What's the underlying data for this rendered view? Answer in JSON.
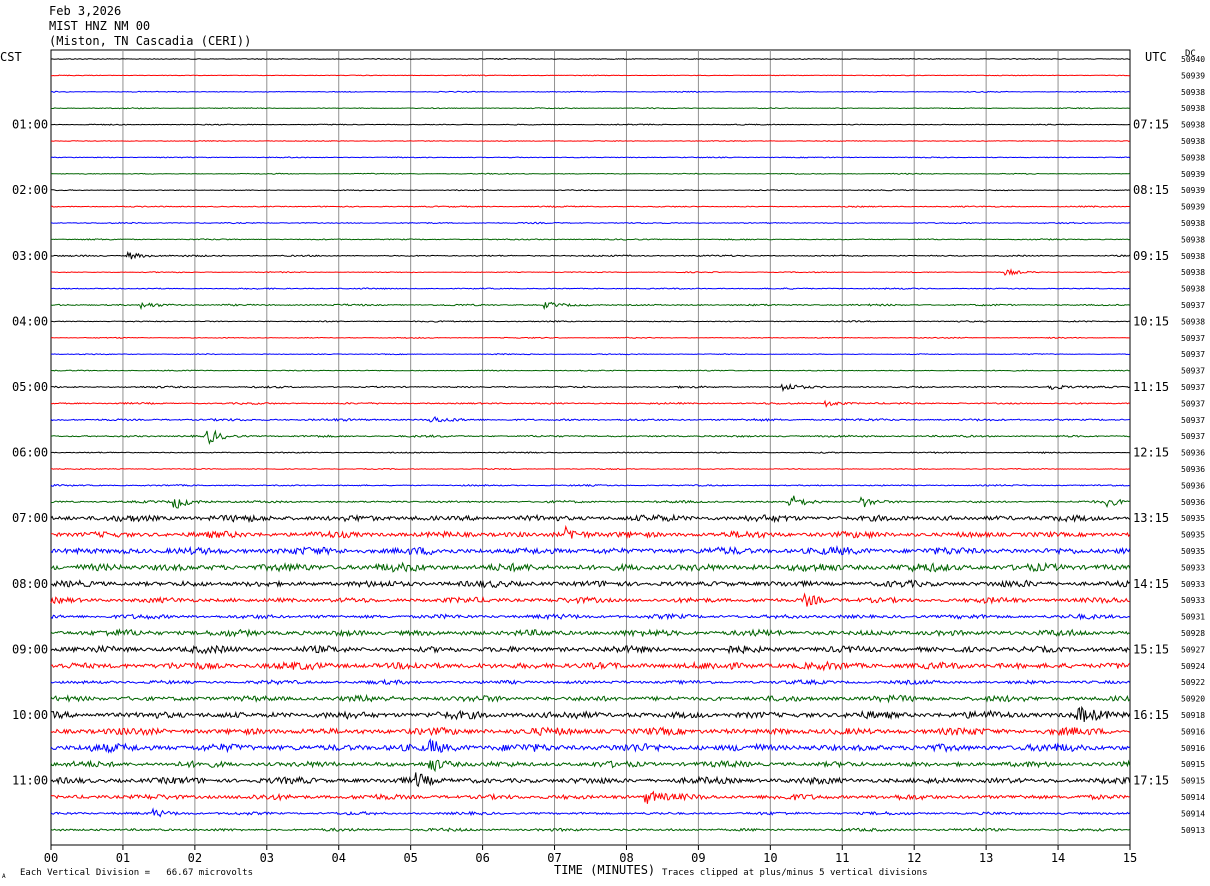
{
  "header": {
    "date": "Feb 3,2026",
    "station": "MIST HNZ NM 00",
    "location": "(Miston, TN Cascadia (CERI))"
  },
  "left_tz": "CST",
  "right_tz": "UTC",
  "dc_label": "DC",
  "footer": {
    "scale_note": "Each Vertical Division =   66.67 microvolts",
    "clip_note": "Traces clipped at plus/minus 5 vertical divisions",
    "mark": "A"
  },
  "chart_data": {
    "type": "line",
    "title": "MIST HNZ NM 00",
    "xlabel": "TIME (MINUTES)",
    "ylabel": "",
    "xlim": [
      0,
      15
    ],
    "x_ticks": [
      "00",
      "01",
      "02",
      "03",
      "04",
      "05",
      "06",
      "07",
      "08",
      "09",
      "10",
      "11",
      "12",
      "13",
      "14",
      "15"
    ],
    "left_hour_labels": [
      {
        "row": 4,
        "text": "01:00"
      },
      {
        "row": 8,
        "text": "02:00"
      },
      {
        "row": 12,
        "text": "03:00"
      },
      {
        "row": 16,
        "text": "04:00"
      },
      {
        "row": 20,
        "text": "05:00"
      },
      {
        "row": 24,
        "text": "06:00"
      },
      {
        "row": 28,
        "text": "07:00"
      },
      {
        "row": 32,
        "text": "08:00"
      },
      {
        "row": 36,
        "text": "09:00"
      },
      {
        "row": 40,
        "text": "10:00"
      },
      {
        "row": 44,
        "text": "11:00"
      }
    ],
    "right_hour_labels": [
      {
        "row": 4,
        "text": "07:15"
      },
      {
        "row": 8,
        "text": "08:15"
      },
      {
        "row": 12,
        "text": "09:15"
      },
      {
        "row": 16,
        "text": "10:15"
      },
      {
        "row": 20,
        "text": "11:15"
      },
      {
        "row": 24,
        "text": "12:15"
      },
      {
        "row": 28,
        "text": "13:15"
      },
      {
        "row": 32,
        "text": "14:15"
      },
      {
        "row": 36,
        "text": "15:15"
      },
      {
        "row": 40,
        "text": "16:15"
      },
      {
        "row": 44,
        "text": "17:15"
      }
    ],
    "trace_colors": [
      "#000000",
      "#ff0000",
      "#0000ff",
      "#006400"
    ],
    "grid_color": "#909090",
    "dc_offsets": [
      "50940",
      "50939",
      "50938",
      "50938",
      "50938",
      "50938",
      "50938",
      "50939",
      "50939",
      "50939",
      "50938",
      "50938",
      "50938",
      "50938",
      "50938",
      "50937",
      "50938",
      "50937",
      "50937",
      "50937",
      "50937",
      "50937",
      "50937",
      "50937",
      "50936",
      "50936",
      "50936",
      "50936",
      "50935",
      "50935",
      "50935",
      "50933",
      "50933",
      "50933",
      "50931",
      "50928",
      "50927",
      "50924",
      "50922",
      "50920",
      "50918",
      "50916",
      "50916",
      "50915",
      "50915",
      "50914",
      "50914",
      "50913"
    ],
    "trace_amplitude": [
      0.4,
      0.3,
      0.4,
      0.4,
      0.4,
      0.3,
      0.4,
      0.4,
      0.4,
      0.5,
      0.5,
      0.5,
      0.6,
      0.4,
      0.5,
      0.7,
      0.5,
      0.4,
      0.4,
      0.4,
      0.7,
      0.7,
      0.9,
      0.8,
      0.5,
      0.4,
      0.6,
      0.9,
      2.6,
      2.6,
      3.0,
      3.2,
      2.6,
      2.2,
      1.8,
      2.6,
      2.8,
      3.0,
      1.6,
      2.4,
      3.0,
      3.0,
      3.2,
      2.4,
      2.6,
      2.2,
      1.2,
      1.2
    ],
    "events": [
      {
        "row": 12,
        "minute": 1.1,
        "amplitude": 3.5
      },
      {
        "row": 13,
        "minute": 13.3,
        "amplitude": 3
      },
      {
        "row": 15,
        "minute": 1.3,
        "amplitude": 3
      },
      {
        "row": 15,
        "minute": 6.9,
        "amplitude": 3
      },
      {
        "row": 20,
        "minute": 10.2,
        "amplitude": 3.5
      },
      {
        "row": 20,
        "minute": 13.9,
        "amplitude": 3
      },
      {
        "row": 21,
        "minute": 10.8,
        "amplitude": 3
      },
      {
        "row": 22,
        "minute": 5.3,
        "amplitude": 3
      },
      {
        "row": 23,
        "minute": 2.2,
        "amplitude": 7
      },
      {
        "row": 27,
        "minute": 1.75,
        "amplitude": 6
      },
      {
        "row": 27,
        "minute": 10.3,
        "amplitude": 6
      },
      {
        "row": 27,
        "minute": 11.3,
        "amplitude": 5
      },
      {
        "row": 27,
        "minute": 14.7,
        "amplitude": 4
      },
      {
        "row": 29,
        "minute": 7.2,
        "amplitude": 6
      },
      {
        "row": 33,
        "minute": 10.5,
        "amplitude": 5
      },
      {
        "row": 40,
        "minute": 14.3,
        "amplitude": 6
      },
      {
        "row": 42,
        "minute": 5.3,
        "amplitude": 6
      },
      {
        "row": 43,
        "minute": 5.3,
        "amplitude": 6
      },
      {
        "row": 44,
        "minute": 5.1,
        "amplitude": 6
      },
      {
        "row": 45,
        "minute": 8.3,
        "amplitude": 6
      },
      {
        "row": 46,
        "minute": 1.45,
        "amplitude": 4
      }
    ]
  }
}
